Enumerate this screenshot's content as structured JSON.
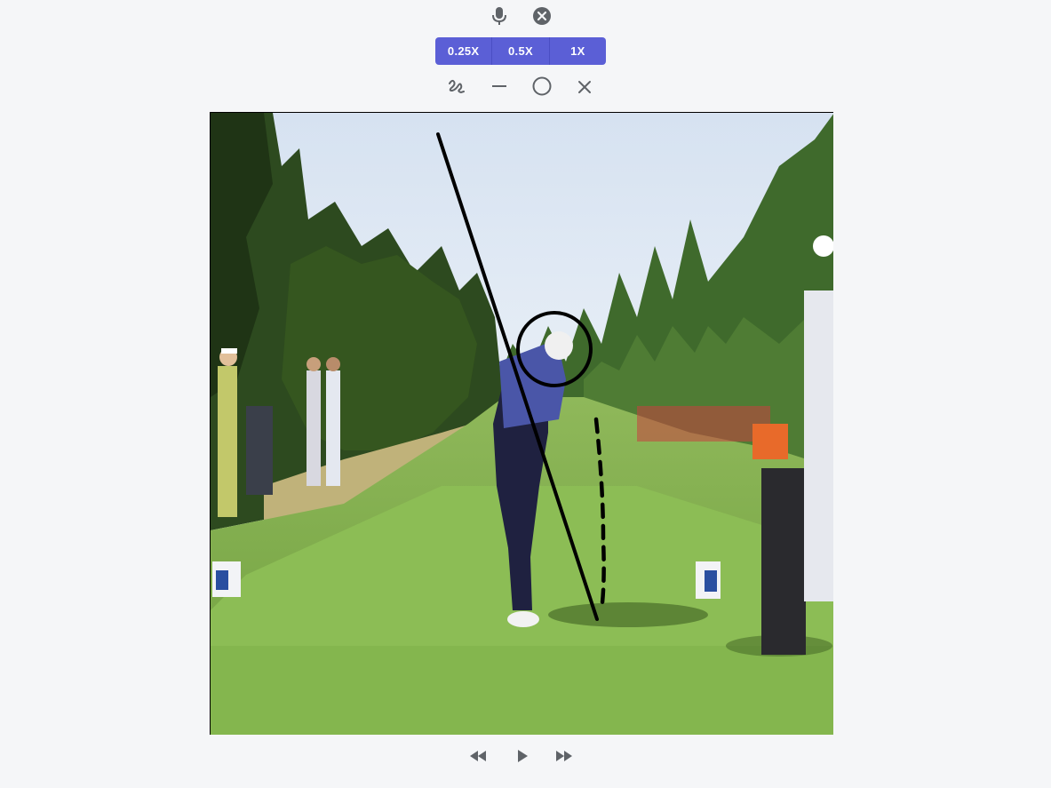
{
  "toolbar": {
    "top_icons": [
      "microphone-icon",
      "close-circle-icon"
    ],
    "speed_options": [
      "0.25X",
      "0.5X",
      "1X"
    ],
    "drawing_tools": [
      "freehand-draw-icon",
      "line-tool-icon",
      "circle-tool-icon",
      "clear-drawing-icon"
    ]
  },
  "video": {
    "description_icons": [
      "golf-swing-video"
    ]
  },
  "playback": {
    "controls": [
      "rewind-icon",
      "play-icon",
      "fast-forward-icon"
    ]
  },
  "colors": {
    "accent": "#5b5fd6",
    "icon": "#5f6368",
    "background": "#f5f6f8",
    "annotation": "#000000"
  }
}
